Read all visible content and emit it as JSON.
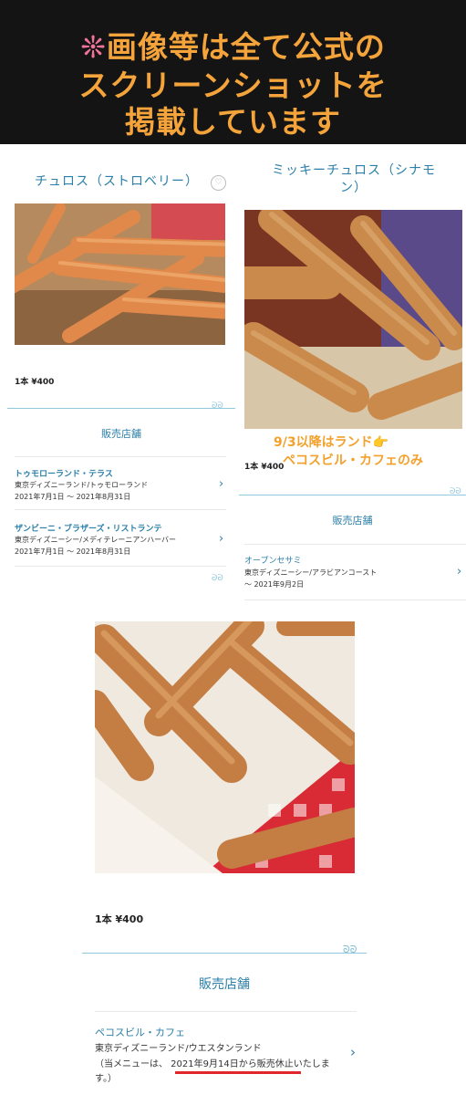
{
  "banner": {
    "line1_mark": "❊",
    "line1": "画像等は全て公式の",
    "line2": "スクリーンショットを",
    "line3": "掲載しています"
  },
  "left_product": {
    "title": "チュロス（ストロベリー）",
    "price": "1本 ¥400",
    "section_title": "販売店舗",
    "shops": [
      {
        "name": "トゥモローランド・テラス",
        "location": "東京ディズニーランド/トゥモローランド",
        "period": "2021年7月1日 〜 2021年8月31日"
      },
      {
        "name": "ザンビーニ・ブラザーズ・リストランテ",
        "location": "東京ディズニーシー/メディテレーニアンハーバー",
        "period": "2021年7月1日 〜 2021年8月31日"
      }
    ]
  },
  "right_product": {
    "title": "ミッキーチュロス（シナモン）",
    "note_line1": "9/3以降はランド👉",
    "note_line2": "ペコスビル・カフェのみ",
    "price": "1本 ¥400",
    "section_title": "販売店舗",
    "shops": [
      {
        "name": "オープンセサミ",
        "location": "東京ディズニーシー/アラビアンコースト",
        "period": "〜 2021年9月2日"
      }
    ]
  },
  "bottom_product": {
    "price": "1本 ¥400",
    "section_title": "販売店舗",
    "shop": {
      "name": "ペコスビル・カフェ",
      "location": "東京ディズニーランド/ウエスタンランド",
      "note_line1": "（当メニューは、 2021年9月14日から販売休止いたしま",
      "note_line2": "す。）"
    }
  },
  "icons": {
    "heart": "heart-icon",
    "chevron": "chevron-right-icon",
    "mickey": "mickey-divider-icon"
  },
  "colors": {
    "banner_text": "#f4a43a",
    "accent": "#2b7fa8",
    "note_orange": "#f2a12c",
    "underline_red": "#e0262a"
  }
}
